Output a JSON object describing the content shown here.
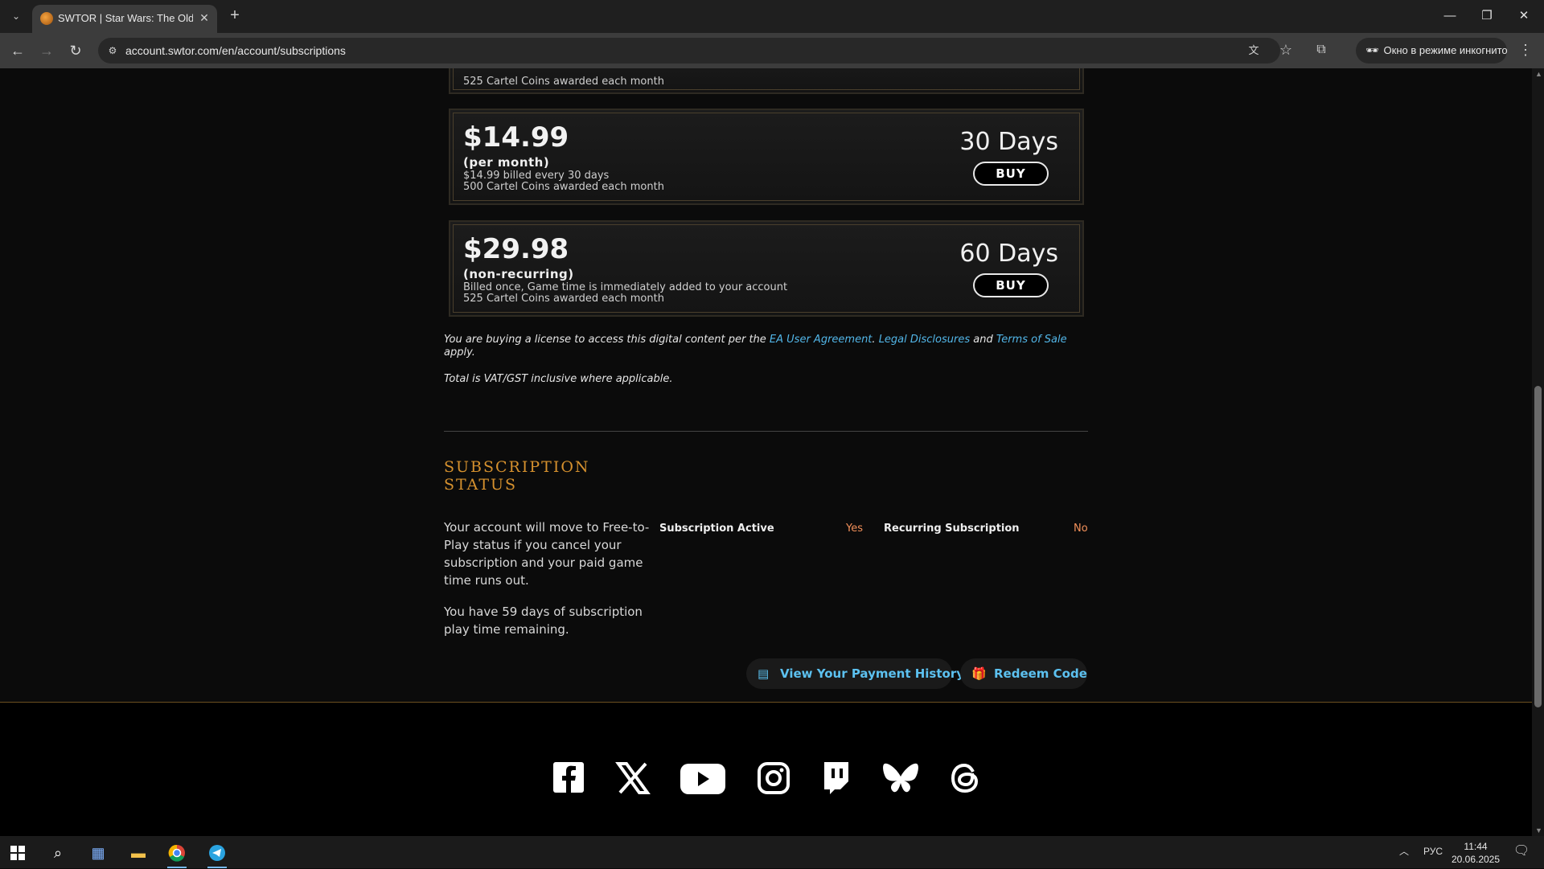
{
  "browser": {
    "tab_title": "SWTOR | Star Wars: The Old Re",
    "url": "account.swtor.com/en/account/subscriptions",
    "incognito_label": "Окно в режиме инкогнито"
  },
  "plans_partial": {
    "top_detail": "525 Cartel Coins awarded each month"
  },
  "plans": [
    {
      "price": "$14.99",
      "period": "(per month)",
      "detail_1": "$14.99 billed every 30 days",
      "detail_2": "500 Cartel Coins awarded each month",
      "duration": "30 Days",
      "buy_label": "BUY"
    },
    {
      "price": "$29.98",
      "period": "(non-recurring)",
      "detail_1": "Billed once, Game time is immediately added to your account",
      "detail_2": "525 Cartel Coins awarded each month",
      "duration": "60 Days",
      "buy_label": "BUY"
    }
  ],
  "legal": {
    "prefix": "You are buying a license to access this digital content per the ",
    "link_1": "EA User Agreement",
    "sep_1": ". ",
    "link_2": "Legal Disclosures",
    "sep_2": " and ",
    "link_3": "Terms of Sale",
    "suffix": " apply.",
    "vat": "Total is VAT/GST inclusive where applicable."
  },
  "subscription_status": {
    "heading_line1": "SUBSCRIPTION",
    "heading_line2": "STATUS",
    "para_1": "Your account will move to Free-to-Play status if you cancel your subscription and your paid game time runs out.",
    "para_2": "You have 59 days of subscription play time remaining.",
    "active_label": "Subscription Active",
    "active_value": "Yes",
    "recurring_label": "Recurring Subscription",
    "recurring_value": "No",
    "payment_history_label": "View Your Payment History",
    "redeem_label": "Redeem Code"
  },
  "taskbar": {
    "language": "РУС",
    "time": "11:44",
    "date": "20.06.2025"
  },
  "colors": {
    "accent_gold": "#d6912e",
    "link_blue": "#52b6e8",
    "status_value": "#f2905a"
  }
}
